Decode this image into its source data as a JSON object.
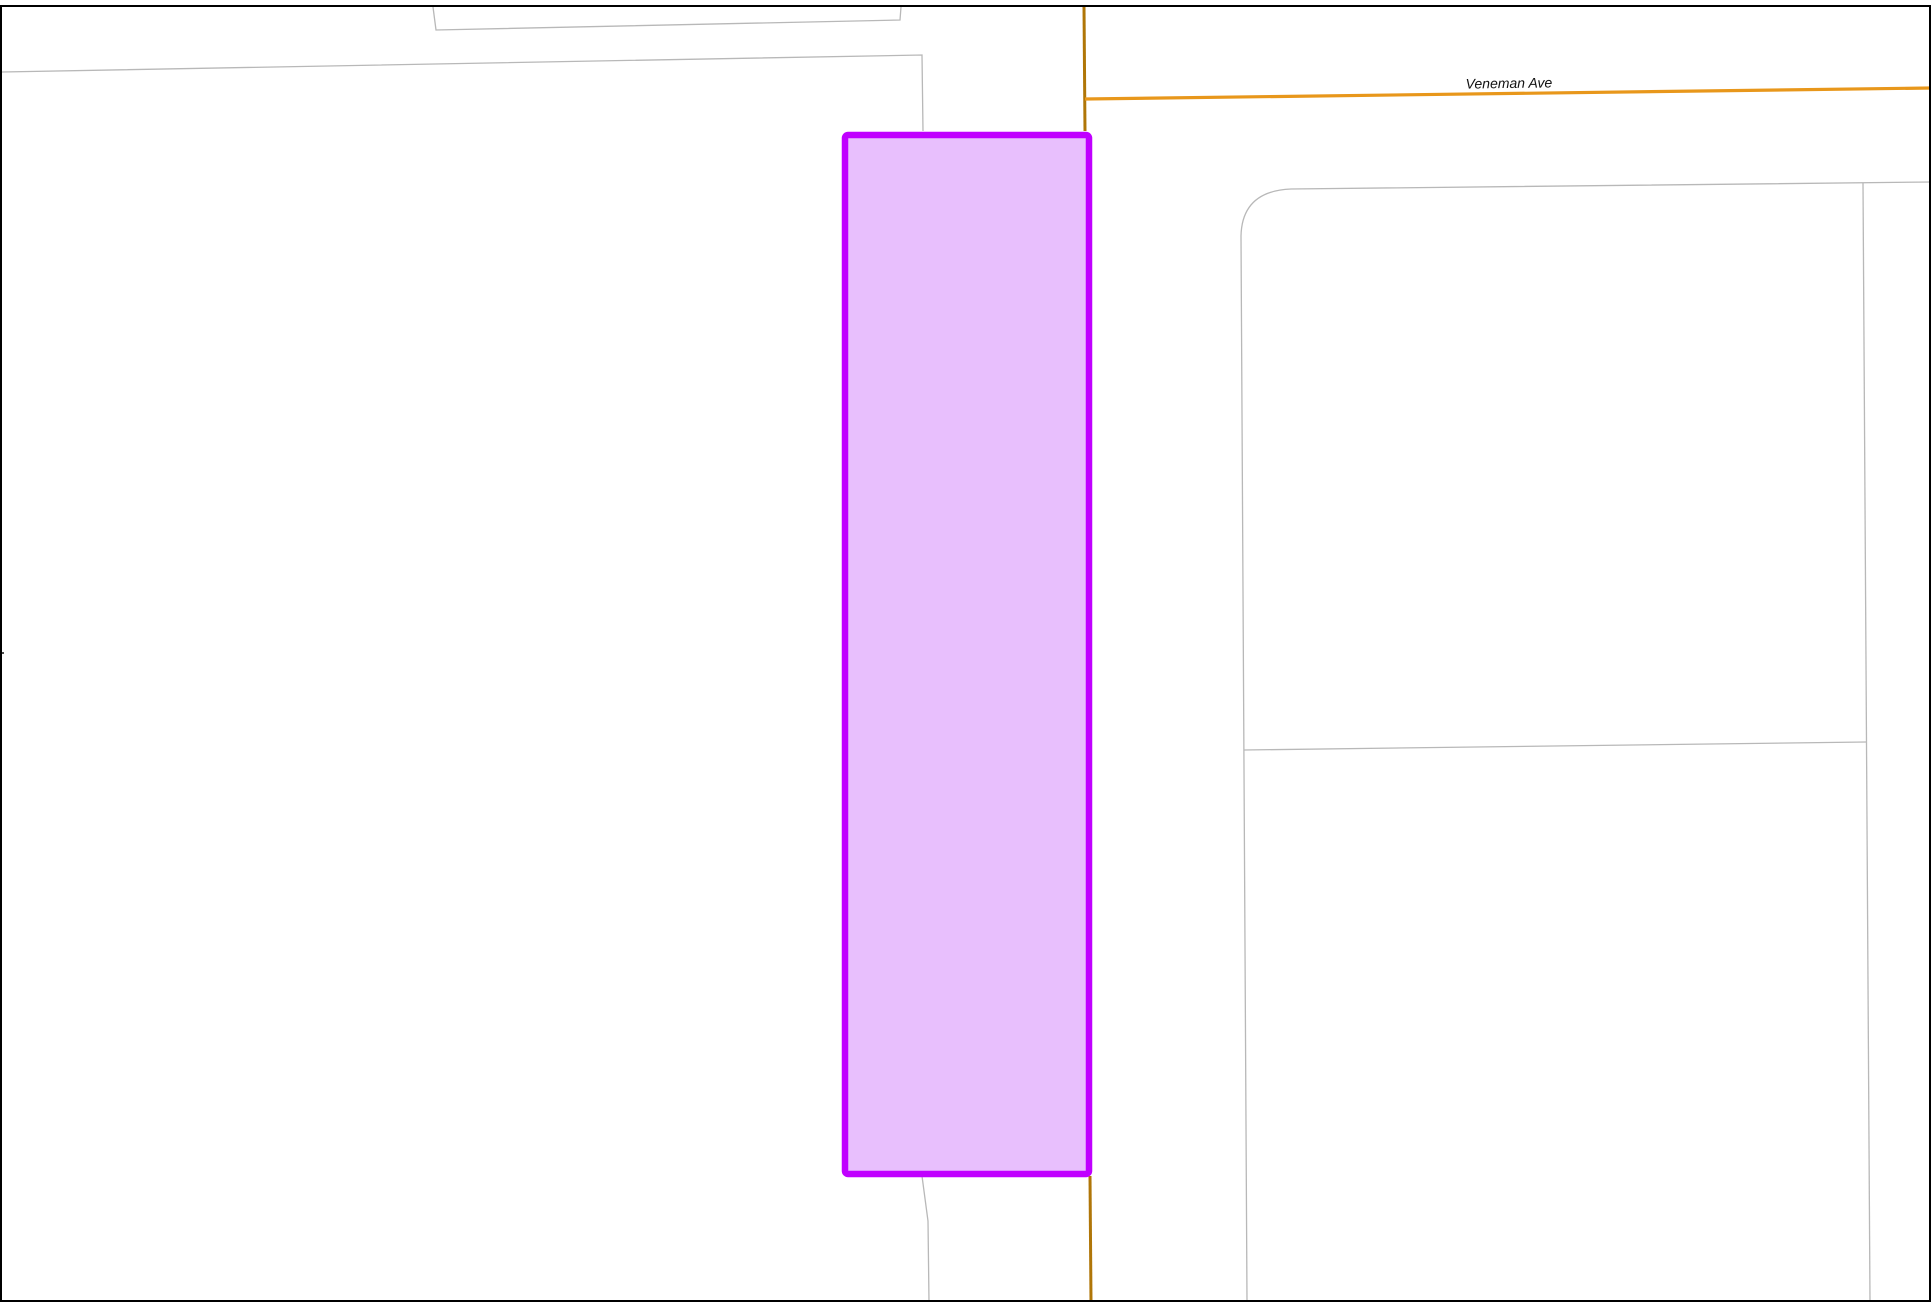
{
  "map": {
    "background_color": "#ffffff",
    "frame_color": "#000000",
    "parcel_line_color": "#b8b8b8",
    "street_labels": {
      "veneman": "Veneman Ave"
    },
    "roads": {
      "veneman_ave_color": "#e8971b",
      "vertical_road_color": "#b07608"
    },
    "highlighted_parcel": {
      "fill_color": "#e8bffd",
      "outline_color": "#c000ff"
    }
  }
}
